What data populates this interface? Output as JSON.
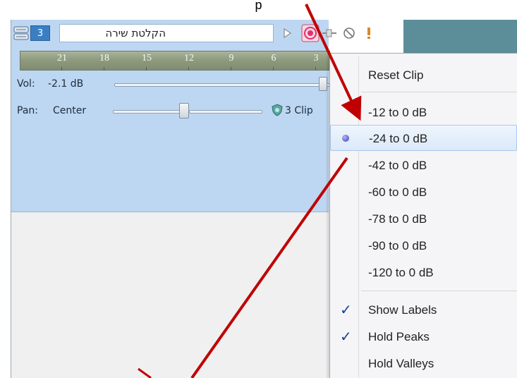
{
  "caption": "p",
  "track": {
    "number": "3",
    "name": "הקלטת שירה",
    "vol_label": "Vol:",
    "vol_value": "-2.1 dB",
    "vol_level_fraction": 0.96,
    "pan_label": "Pan:",
    "pan_value": "Center",
    "pan_level_fraction": 0.5,
    "clip_label": "3 Clip"
  },
  "meter": {
    "ticks": [
      "21",
      "18",
      "15",
      "12",
      "9",
      "6",
      "3"
    ]
  },
  "context_menu": {
    "reset": "Reset Clip",
    "ranges": [
      {
        "label": "-12 to 0 dB",
        "selected": false
      },
      {
        "label": "-24 to 0 dB",
        "selected": true
      },
      {
        "label": "-42 to 0 dB",
        "selected": false
      },
      {
        "label": "-60 to 0 dB",
        "selected": false
      },
      {
        "label": "-78 to 0 dB",
        "selected": false
      },
      {
        "label": "-90 to 0 dB",
        "selected": false
      },
      {
        "label": "-120 to 0 dB",
        "selected": false
      }
    ],
    "options": [
      {
        "label": "Show Labels",
        "checked": true
      },
      {
        "label": "Hold Peaks",
        "checked": true
      },
      {
        "label": "Hold Valleys",
        "checked": false
      }
    ]
  },
  "colors": {
    "track_panel": "#bdd6f2",
    "arrow": "#c00000",
    "record_arm": "#e03070"
  }
}
